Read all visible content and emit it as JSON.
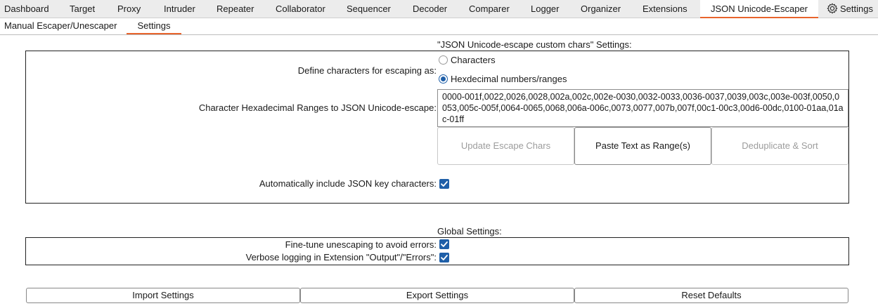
{
  "tabs": [
    {
      "label": "Dashboard"
    },
    {
      "label": "Target"
    },
    {
      "label": "Proxy"
    },
    {
      "label": "Intruder"
    },
    {
      "label": "Repeater"
    },
    {
      "label": "Collaborator"
    },
    {
      "label": "Sequencer"
    },
    {
      "label": "Decoder"
    },
    {
      "label": "Comparer"
    },
    {
      "label": "Logger"
    },
    {
      "label": "Organizer"
    },
    {
      "label": "Extensions"
    },
    {
      "label": "JSON Unicode-Escaper",
      "active": true
    },
    {
      "label": "Settings",
      "icon": "gear-icon"
    }
  ],
  "subtabs": [
    {
      "label": "Manual Escaper/Unescaper"
    },
    {
      "label": "Settings",
      "active": true
    }
  ],
  "custom_section": {
    "title": "\"JSON Unicode-escape custom chars\" Settings:",
    "define_label": "Define characters for escaping as:",
    "radio_characters": "Characters",
    "radio_hex": "Hexdecimal numbers/ranges",
    "radio_selected": "Hexdecimal numbers/ranges",
    "ranges_label": "Character Hexadecimal Ranges to JSON Unicode-escape:",
    "ranges_value": "0000-001f,0022,0026,0028,002a,002c,002e-0030,0032-0033,0036-0037,0039,003c,003e-003f,0050,0053,005c-005f,0064-0065,0068,006a-006c,0073,0077,007b,007f,00c1-00c3,00d6-00dc,0100-01aa,01ac-01ff",
    "btn_update": "Update Escape Chars",
    "btn_paste": "Paste Text as Range(s)",
    "btn_dedup": "Deduplicate & Sort",
    "auto_include_label": "Automatically include JSON key characters:",
    "auto_include_checked": true
  },
  "global_section": {
    "title": "Global Settings:",
    "finetune_label": "Fine-tune unescaping to avoid errors:",
    "finetune_checked": true,
    "verbose_label": "Verbose logging in Extension \"Output\"/\"Errors\":",
    "verbose_checked": true
  },
  "footer": {
    "import": "Import Settings",
    "export": "Export Settings",
    "reset": "Reset Defaults"
  },
  "colors": {
    "accent": "#e8642c",
    "checkbox": "#1f5fa8"
  }
}
